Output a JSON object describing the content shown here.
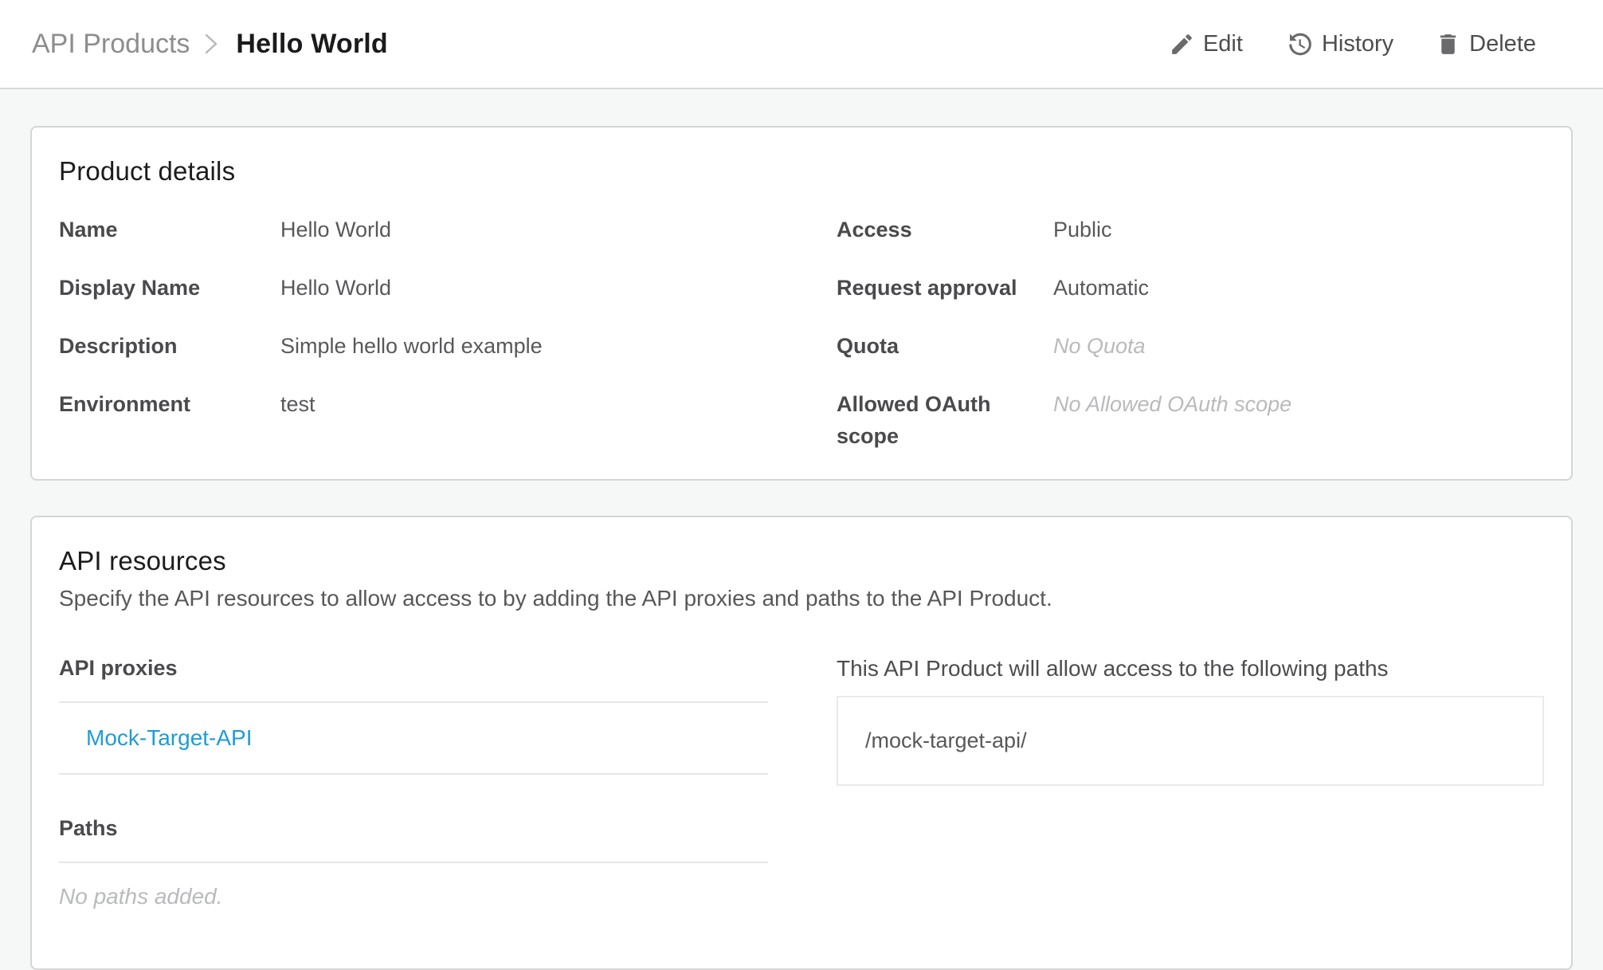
{
  "header": {
    "breadcrumb": {
      "parent": "API Products",
      "current": "Hello World"
    },
    "actions": {
      "edit": "Edit",
      "history": "History",
      "delete": "Delete"
    }
  },
  "colors": {
    "link_blue": "#1e9cd7",
    "icon_gray": "#6a6a6d",
    "page_background": "#f6f7f7",
    "muted_text": "#b9babc"
  },
  "icons": {
    "edit": "pencil-icon",
    "history": "clock-history-icon",
    "delete": "trash-icon",
    "breadcrumb": "chevron-right-icon"
  },
  "product_details": {
    "title": "Product details",
    "left_fields": [
      {
        "label": "Name",
        "value": "Hello World"
      },
      {
        "label": "Display Name",
        "value": "Hello World"
      },
      {
        "label": "Description",
        "value": "Simple hello world example"
      },
      {
        "label": "Environment",
        "value": "test"
      }
    ],
    "right_fields": [
      {
        "label": "Access",
        "value": "Public"
      },
      {
        "label": "Request approval",
        "value": "Automatic"
      },
      {
        "label": "Quota",
        "value": "No Quota"
      },
      {
        "label": "Allowed OAuth scope",
        "value": "No Allowed OAuth scope"
      }
    ]
  },
  "api_resources": {
    "title": "API resources",
    "subtitle": "Specify the API resources to allow access to by adding the API proxies and paths to the API Product.",
    "proxies_label": "API proxies",
    "proxies": [
      {
        "name": "Mock-Target-API"
      }
    ],
    "paths_label": "Paths",
    "paths_empty": "No paths added.",
    "allowed_paths_heading": "This API Product will allow access to the following paths",
    "allowed_paths": [
      "/mock-target-api/"
    ]
  }
}
